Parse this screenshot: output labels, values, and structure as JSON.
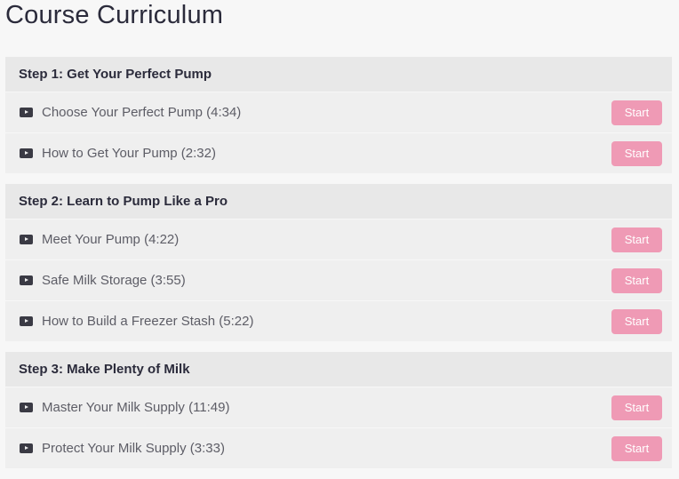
{
  "page": {
    "title": "Course Curriculum"
  },
  "colors": {
    "start_button": "#ef9ab5",
    "section_header_bg": "#e8e8e8",
    "lecture_bg": "#efefef"
  },
  "sections": [
    {
      "title": "Step 1: Get Your Perfect Pump",
      "lectures": [
        {
          "icon": "play-video-icon",
          "name": "Choose Your Perfect Pump (4:34)",
          "button": "Start"
        },
        {
          "icon": "play-video-icon",
          "name": "How to Get Your Pump (2:32)",
          "button": "Start"
        }
      ]
    },
    {
      "title": "Step 2: Learn to Pump Like a Pro",
      "lectures": [
        {
          "icon": "play-video-icon",
          "name": "Meet Your Pump (4:22)",
          "button": "Start"
        },
        {
          "icon": "play-video-icon",
          "name": "Safe Milk Storage (3:55)",
          "button": "Start"
        },
        {
          "icon": "play-video-icon",
          "name": "How to Build a Freezer Stash (5:22)",
          "button": "Start"
        }
      ]
    },
    {
      "title": "Step 3: Make Plenty of Milk",
      "lectures": [
        {
          "icon": "play-video-icon",
          "name": "Master Your Milk Supply (11:49)",
          "button": "Start"
        },
        {
          "icon": "play-video-icon",
          "name": "Protect Your Milk Supply (3:33)",
          "button": "Start"
        }
      ]
    }
  ]
}
